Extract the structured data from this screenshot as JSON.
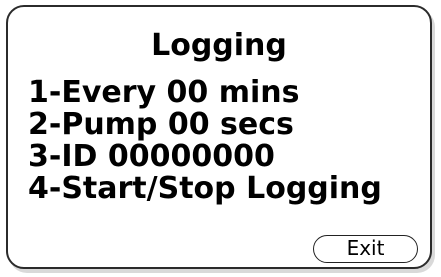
{
  "screen": {
    "title": "Logging",
    "menu_items": [
      {
        "label": "1-Every 00 mins"
      },
      {
        "label": "2-Pump 00 secs"
      },
      {
        "label": "3-ID 00000000"
      },
      {
        "label": "4-Start/Stop Logging"
      }
    ],
    "exit_label": "Exit"
  }
}
